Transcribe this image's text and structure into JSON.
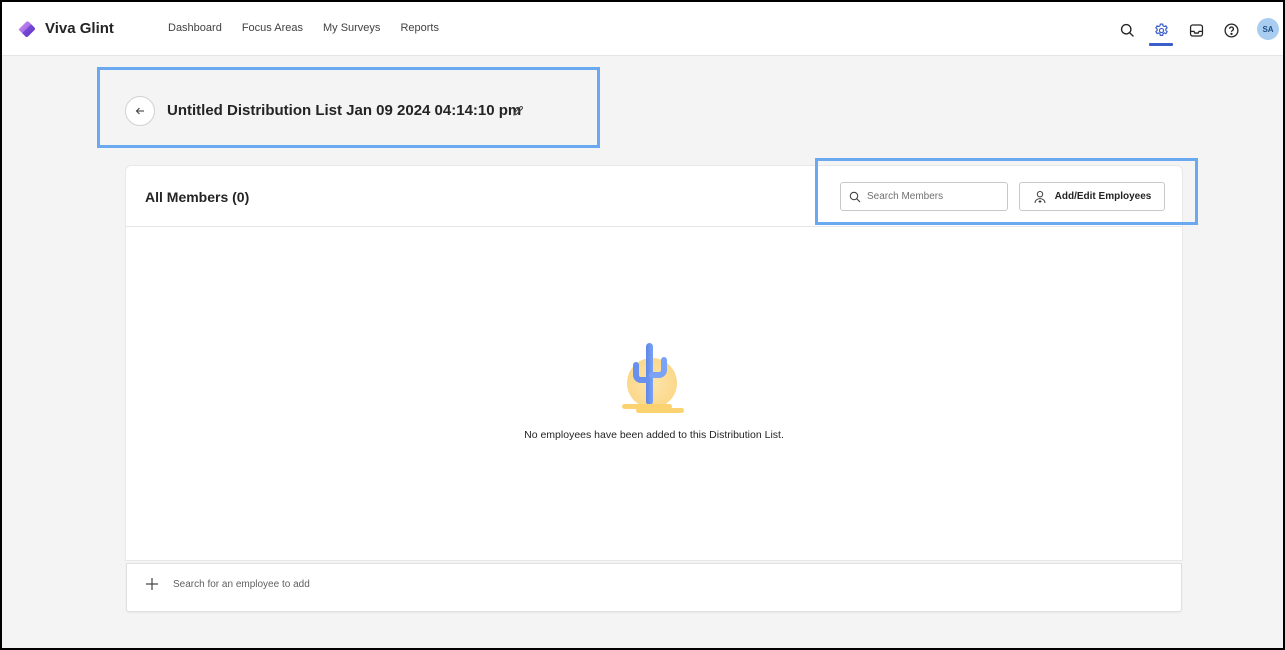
{
  "app": {
    "brand": "Viva Glint",
    "nav": [
      "Dashboard",
      "Focus Areas",
      "My Surveys",
      "Reports"
    ],
    "icons": [
      "search-icon",
      "settings-icon",
      "inbox-icon",
      "help-icon"
    ],
    "active_icon": "settings-icon",
    "avatar_initials": "SA",
    "accent_color": "#3b5fc9"
  },
  "page": {
    "title": "Untitled Distribution List Jan 09 2024 04:14:10 pm",
    "back_icon": "arrow-left-icon",
    "edit_icon": "pencil-icon"
  },
  "members": {
    "title": "All Members (0)",
    "search_placeholder": "Search Members",
    "add_edit_label": "Add/Edit Employees",
    "empty_message": "No employees have been added to this Distribution List."
  },
  "add_bar": {
    "placeholder": "Search for an employee to add"
  }
}
